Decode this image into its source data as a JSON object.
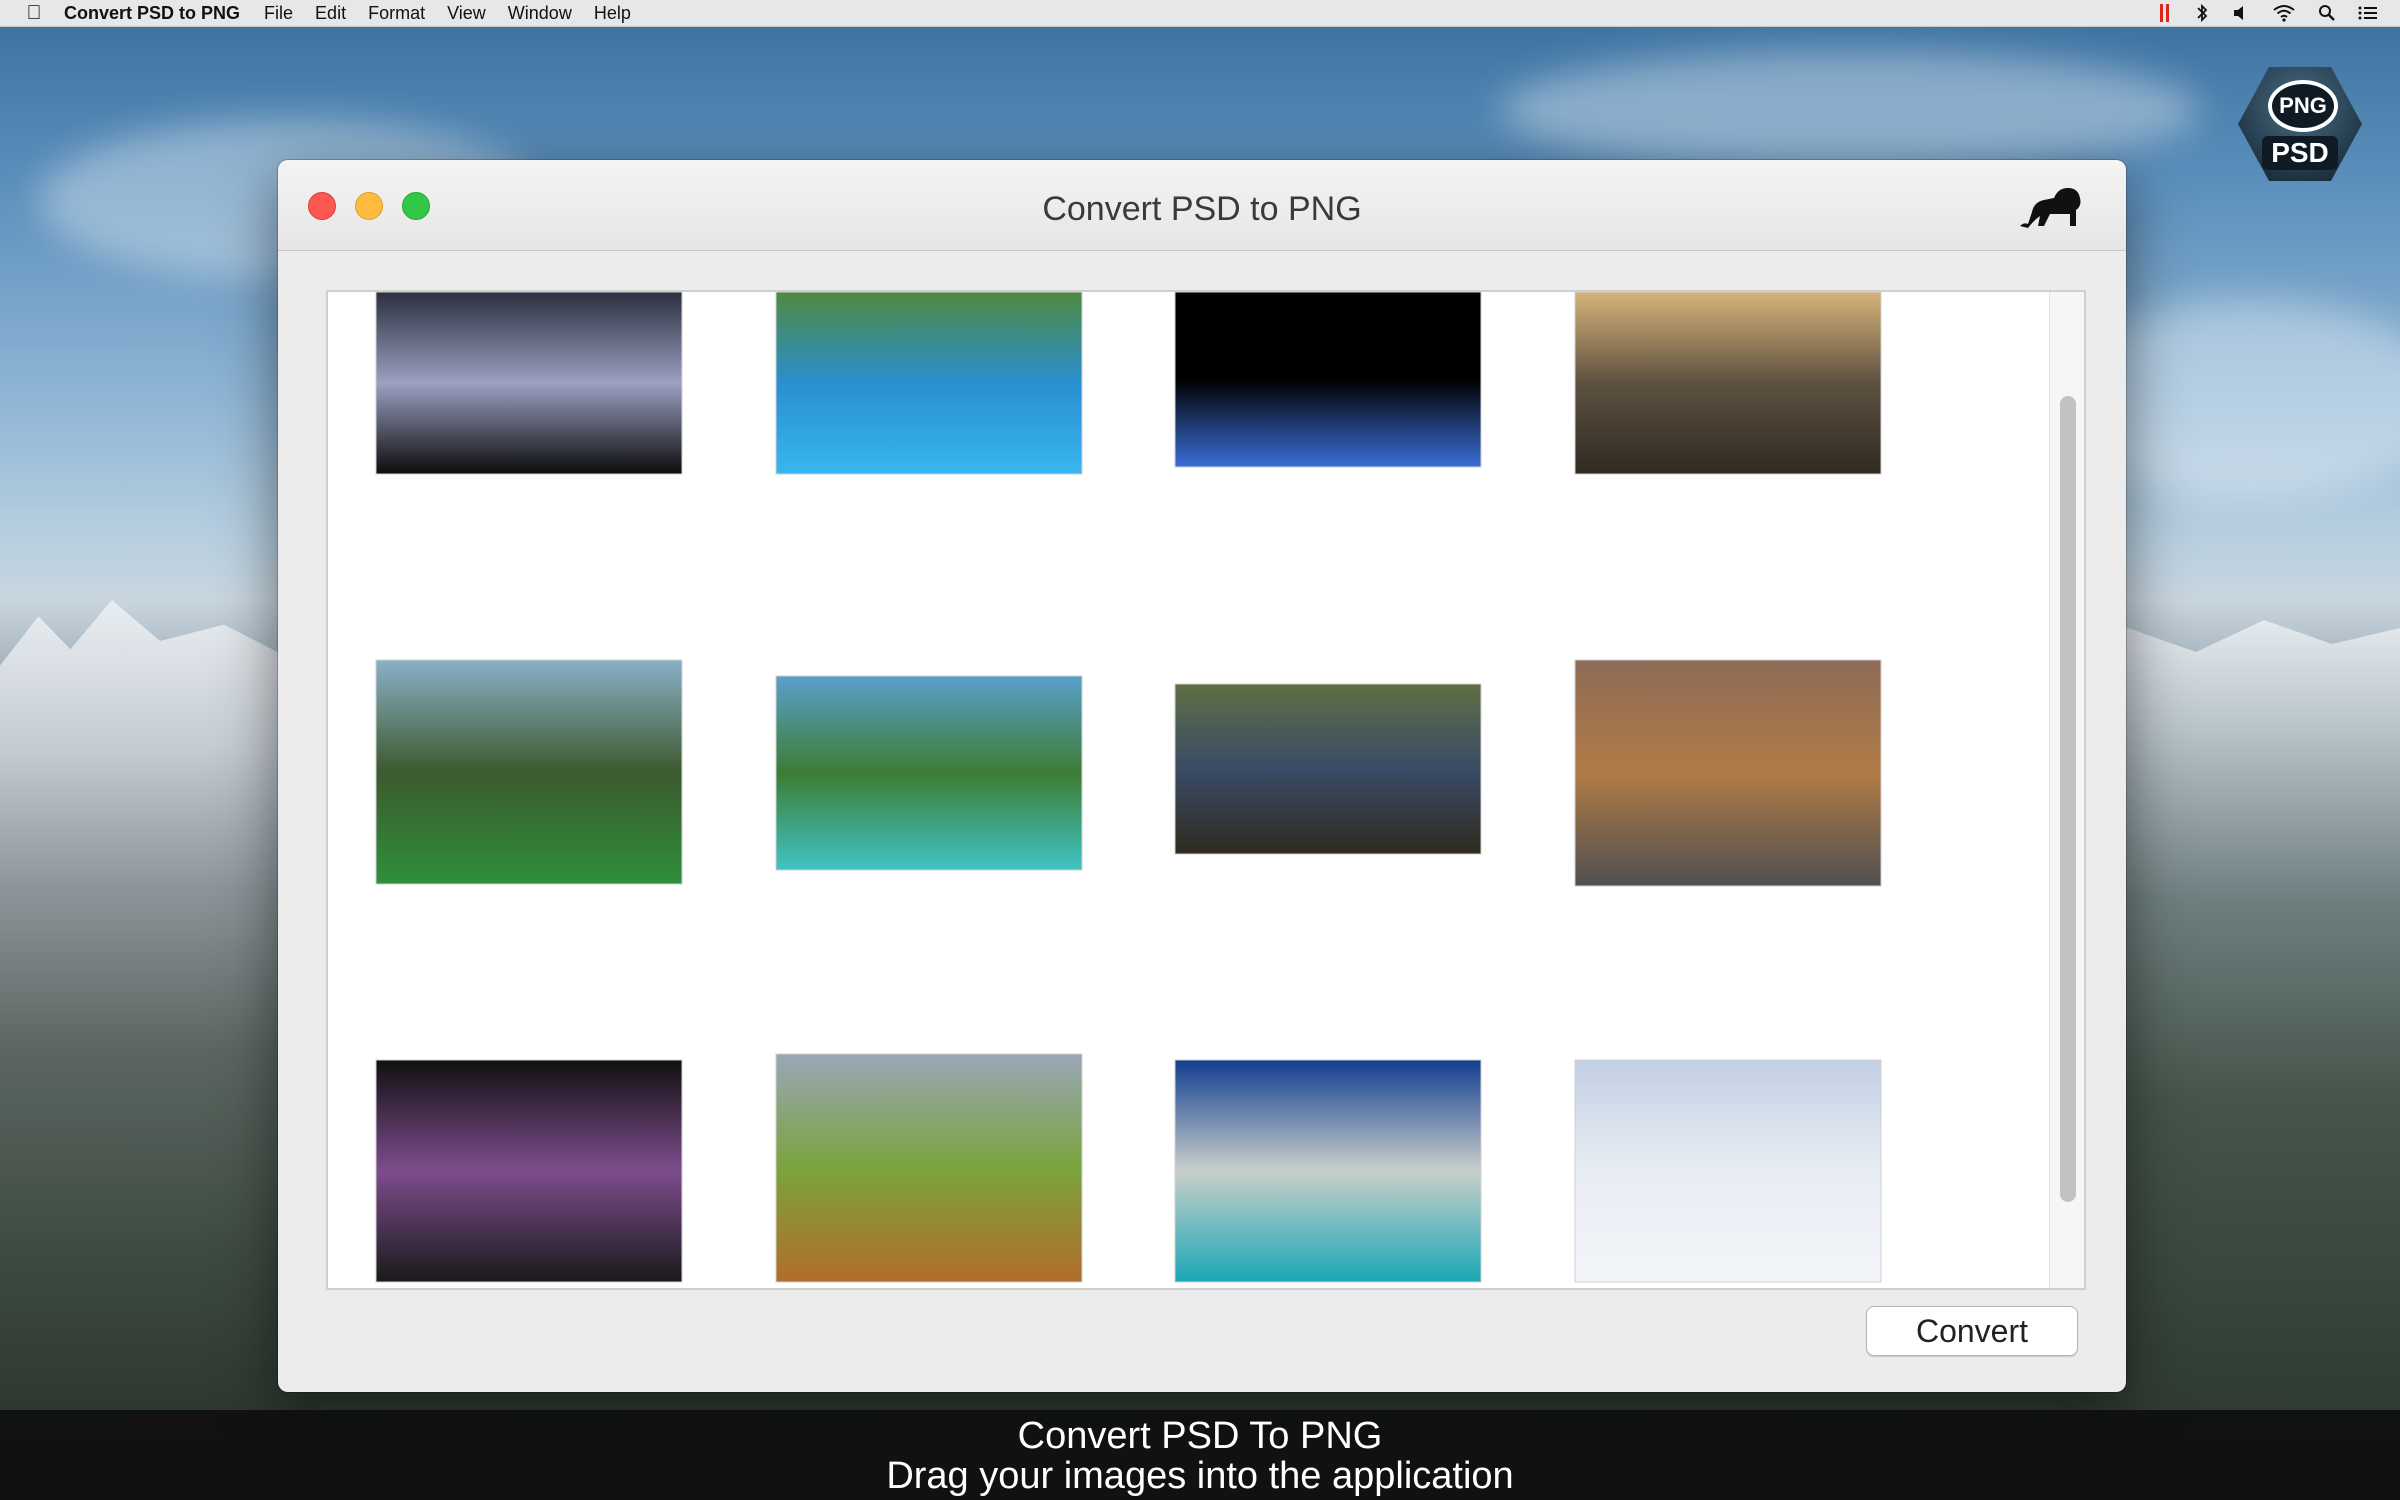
{
  "menubar": {
    "app_name": "Convert PSD to PNG",
    "items": [
      "File",
      "Edit",
      "Format",
      "View",
      "Window",
      "Help"
    ],
    "tray": [
      "pause-icon",
      "bluetooth-icon",
      "volume-icon",
      "wifi-icon",
      "search-icon",
      "list-icon"
    ]
  },
  "app_icon": {
    "top_label": "PNG",
    "bottom_label": "PSD"
  },
  "window": {
    "title": "Convert PSD to PNG",
    "convert_label": "Convert"
  },
  "thumbnails": [
    {
      "name": "lightning-storm",
      "colors": [
        "#2b2f3e",
        "#9ca0c2",
        "#0c0c0c"
      ]
    },
    {
      "name": "resort-pool",
      "colors": [
        "#4f8a41",
        "#2a8fd0",
        "#39b6ef"
      ]
    },
    {
      "name": "earth-from-space",
      "colors": [
        "#000000",
        "#000000",
        "#3a6fd8"
      ]
    },
    {
      "name": "city-skyline-sunset",
      "colors": [
        "#d6b47a",
        "#5e5140",
        "#2f2a22"
      ]
    },
    {
      "name": "lake-boat",
      "colors": [
        "#8ab0c8",
        "#3d5a2f",
        "#2e8f3a"
      ]
    },
    {
      "name": "tropical-beach",
      "colors": [
        "#5aa0cc",
        "#3d7c34",
        "#3fc4c4"
      ]
    },
    {
      "name": "beetle-globe",
      "colors": [
        "#5e6f44",
        "#3a4b66",
        "#2f2a1f"
      ]
    },
    {
      "name": "desert-road",
      "colors": [
        "#8e6b57",
        "#b07b46",
        "#4f4f50"
      ]
    },
    {
      "name": "purple-rose-moon",
      "colors": [
        "#101010",
        "#7d4c8e",
        "#1a1a1a"
      ]
    },
    {
      "name": "fantasy-trees",
      "colors": [
        "#9aa6b7",
        "#7aa43c",
        "#b26c2c"
      ]
    },
    {
      "name": "blue-hole-island",
      "colors": [
        "#123e8f",
        "#c9cfcb",
        "#1aa7b5"
      ]
    },
    {
      "name": "mountain-climber",
      "colors": [
        "#c2d0e4",
        "#e8ecf3",
        "#f3f5f9"
      ]
    }
  ],
  "caption": {
    "line1": "Convert PSD To PNG",
    "line2": "Drag your images into the application"
  }
}
